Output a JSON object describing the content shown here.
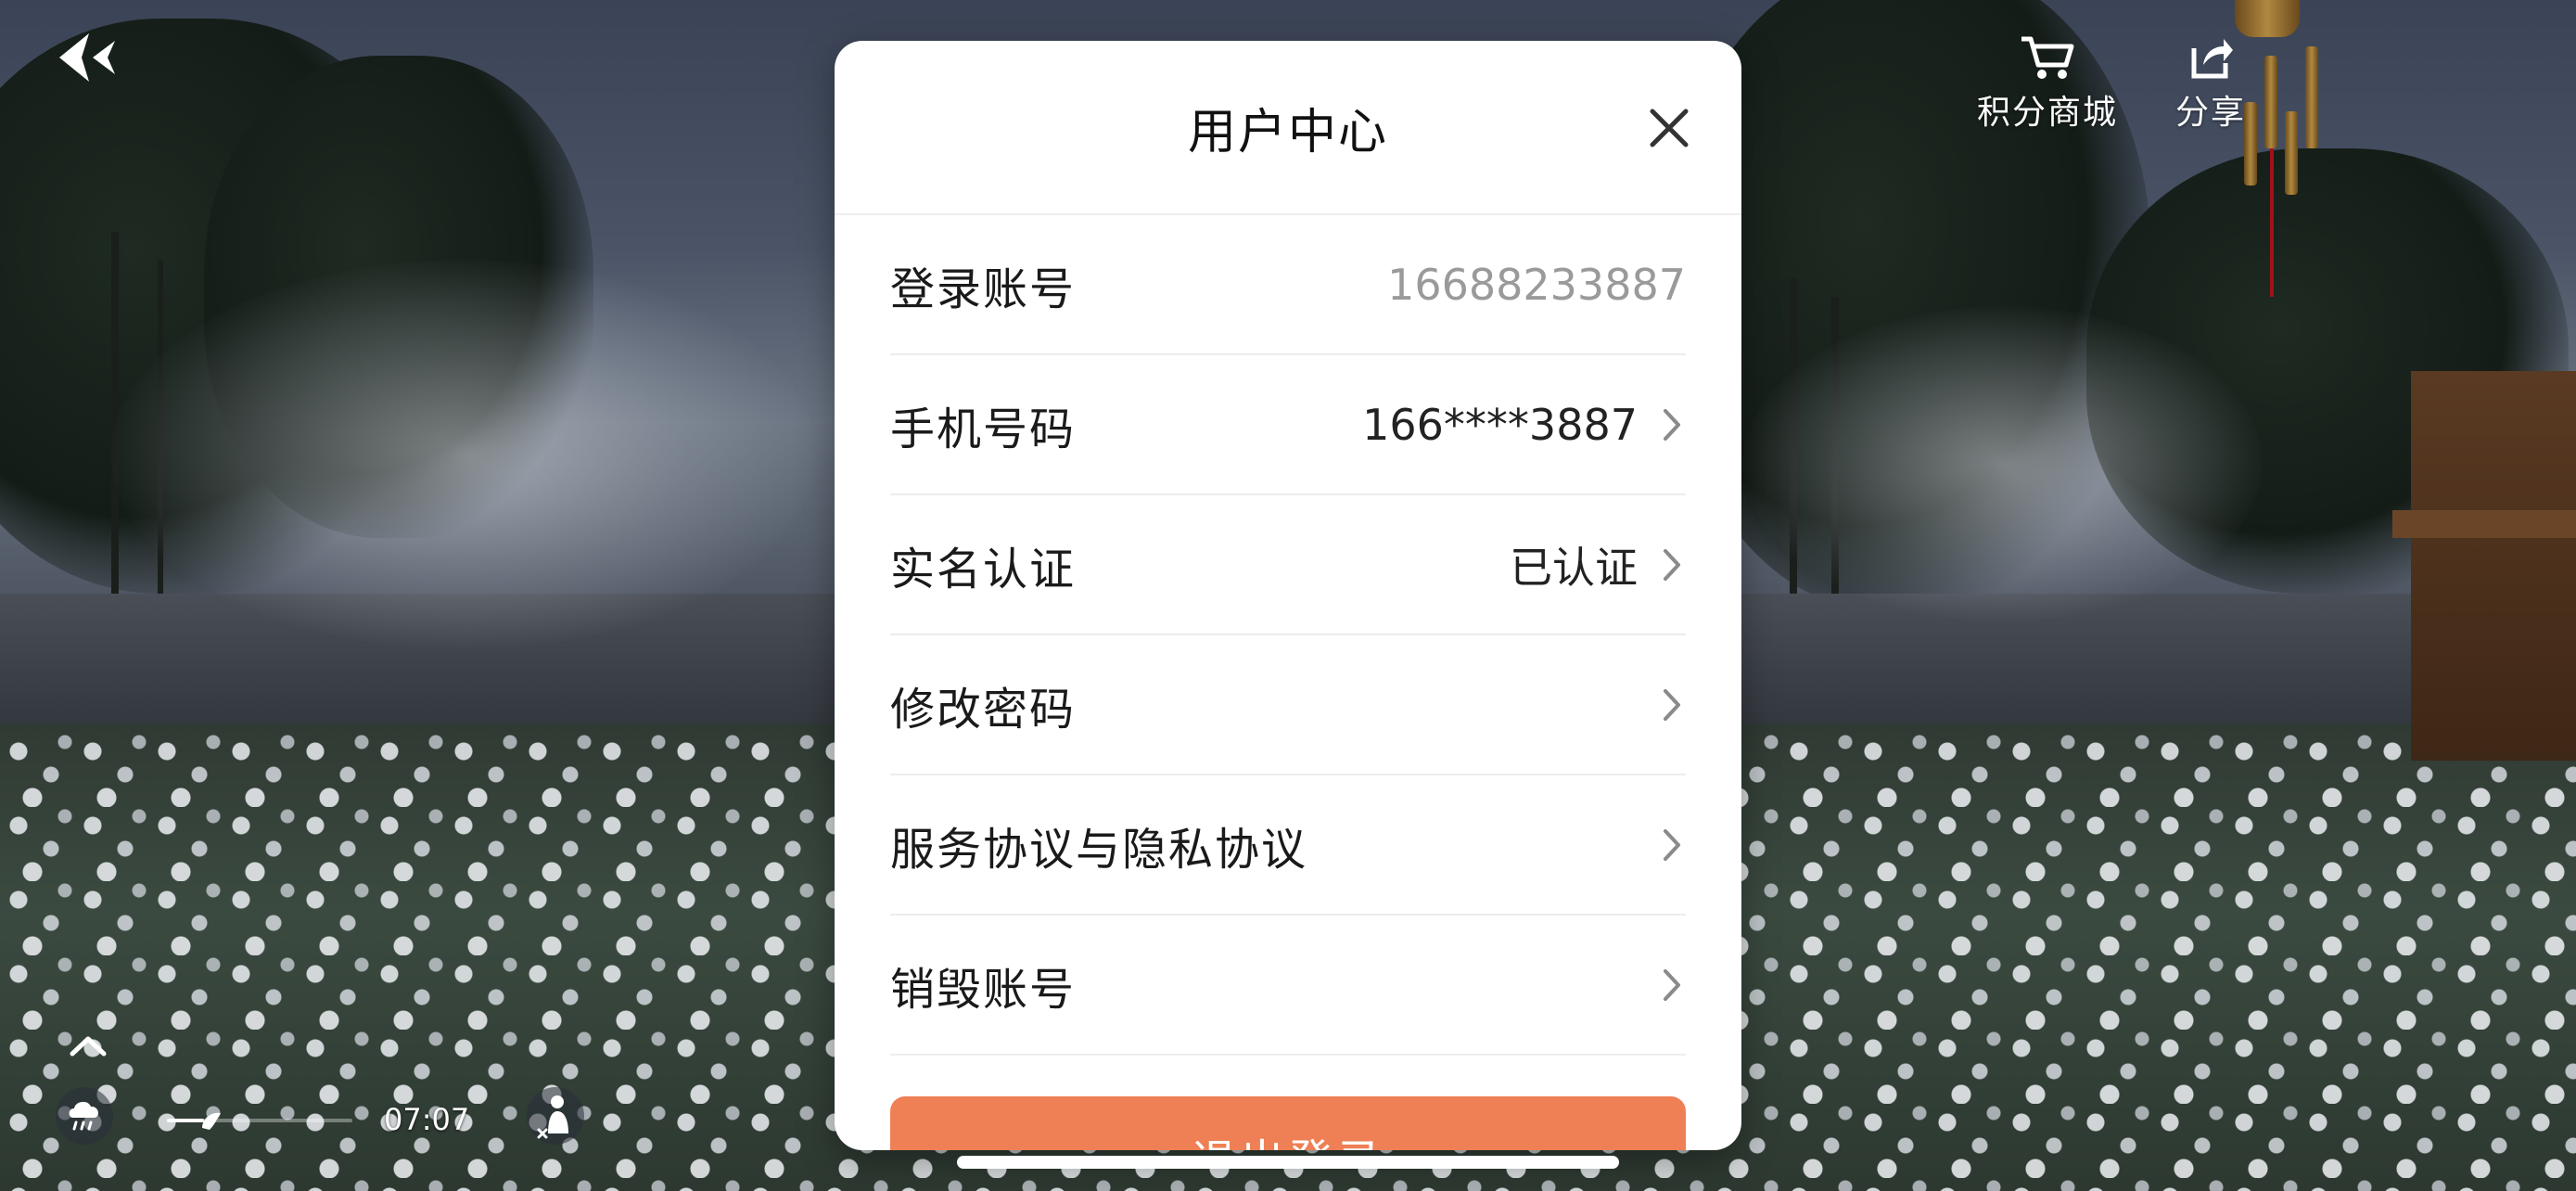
{
  "header": {
    "shop_label": "积分商城",
    "share_label": "分享"
  },
  "player": {
    "timer": "07:07",
    "sound_level_fraction": 0.2
  },
  "modal": {
    "title": "用户中心",
    "rows": [
      {
        "label": "登录账号",
        "value": "16688233887",
        "has_chevron": false
      },
      {
        "label": "手机号码",
        "value": "166****3887",
        "has_chevron": true
      },
      {
        "label": "实名认证",
        "value": "已认证",
        "has_chevron": true
      },
      {
        "label": "修改密码",
        "value": "",
        "has_chevron": true
      },
      {
        "label": "服务协议与隐私协议",
        "value": "",
        "has_chevron": true
      },
      {
        "label": "销毁账号",
        "value": "",
        "has_chevron": true
      }
    ],
    "logout_label": "退出登录"
  },
  "colors": {
    "accent": "#ef7f55",
    "modal_bg": "#ffffff",
    "muted_text": "#9a9a9a"
  },
  "icons": {
    "back": "back-arrow-icon",
    "shop": "cart-icon",
    "share": "share-icon",
    "close": "close-icon",
    "chevron": "chevron-right-icon",
    "weather": "rain-cloud-icon",
    "meditate": "meditation-icon",
    "collapse": "chevron-up-icon"
  }
}
